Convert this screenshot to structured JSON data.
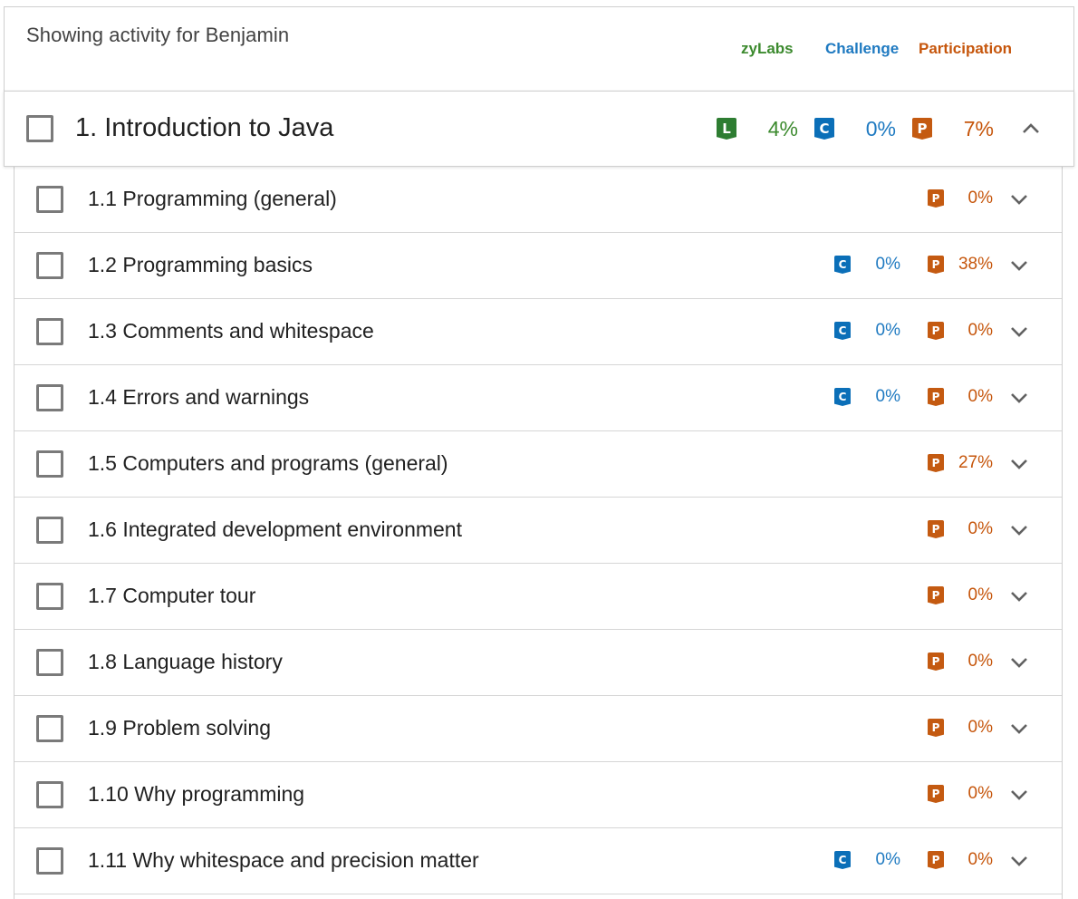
{
  "header": {
    "activity_text": "Showing activity for Benjamin",
    "legend": {
      "zylabs": "zyLabs",
      "challenge": "Challenge",
      "participation": "Participation"
    }
  },
  "badges": {
    "lab": "L",
    "challenge": "C",
    "participation": "P"
  },
  "chapter": {
    "title": "1. Introduction to Java",
    "lab_pct": "4%",
    "challenge_pct": "0%",
    "participation_pct": "7%",
    "expanded_icon": "chevron-up-icon"
  },
  "sections": [
    {
      "title": "1.1 Programming (general)",
      "challenge_pct": null,
      "participation_pct": "0%"
    },
    {
      "title": "1.2 Programming basics",
      "challenge_pct": "0%",
      "participation_pct": "38%"
    },
    {
      "title": "1.3 Comments and whitespace",
      "challenge_pct": "0%",
      "participation_pct": "0%"
    },
    {
      "title": "1.4 Errors and warnings",
      "challenge_pct": "0%",
      "participation_pct": "0%"
    },
    {
      "title": "1.5 Computers and programs (general)",
      "challenge_pct": null,
      "participation_pct": "27%"
    },
    {
      "title": "1.6 Integrated development environment",
      "challenge_pct": null,
      "participation_pct": "0%"
    },
    {
      "title": "1.7 Computer tour",
      "challenge_pct": null,
      "participation_pct": "0%"
    },
    {
      "title": "1.8 Language history",
      "challenge_pct": null,
      "participation_pct": "0%"
    },
    {
      "title": "1.9 Problem solving",
      "challenge_pct": null,
      "participation_pct": "0%"
    },
    {
      "title": "1.10 Why programming",
      "challenge_pct": null,
      "participation_pct": "0%"
    },
    {
      "title": "1.11 Why whitespace and precision matter",
      "challenge_pct": "0%",
      "participation_pct": "0%"
    }
  ],
  "colors": {
    "lab": "#2e7d32",
    "challenge": "#0b6fb8",
    "participation": "#c45a11"
  }
}
